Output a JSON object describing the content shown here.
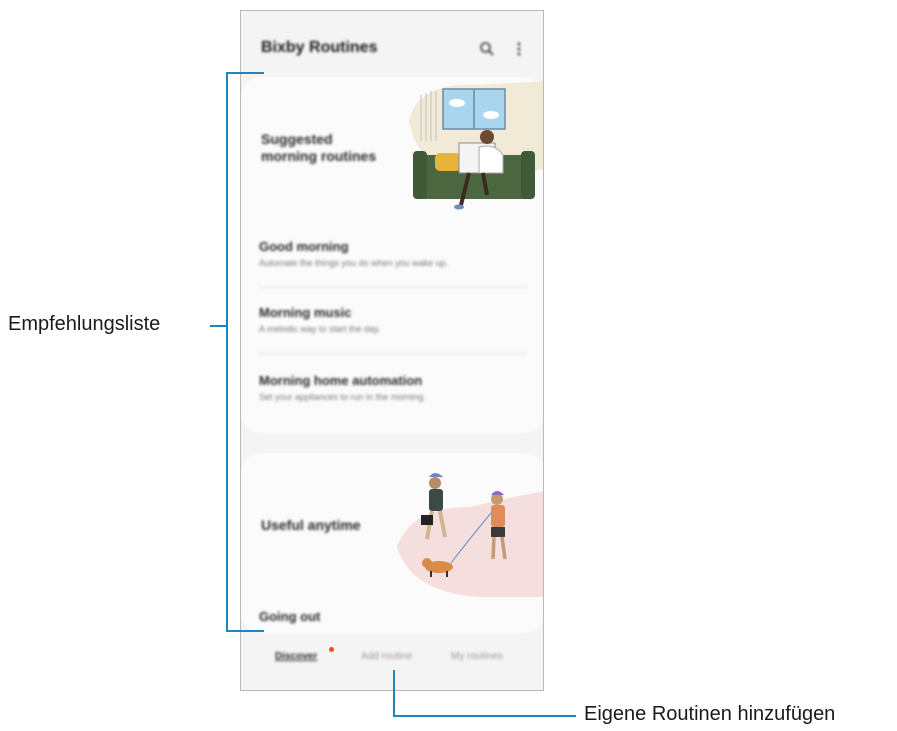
{
  "header": {
    "title": "Bixby Routines",
    "search_icon": "search-icon",
    "more_icon": "more-vertical-icon"
  },
  "suggested": {
    "title_line1": "Suggested",
    "title_line2": "morning routines",
    "items": [
      {
        "title": "Good morning",
        "subtitle": "Automate the things you do when you wake up."
      },
      {
        "title": "Morning music",
        "subtitle": "A melodic way to start the day."
      },
      {
        "title": "Morning home automation",
        "subtitle": "Set your appliances to run in the morning."
      }
    ]
  },
  "useful": {
    "title": "Useful anytime",
    "first_item": "Going out"
  },
  "bottom_nav": {
    "tabs": [
      "Discover",
      "Add routine",
      "My routines"
    ],
    "active": "Discover",
    "notification_color": "#e8502f"
  },
  "callouts": {
    "left": "Empfehlungsliste",
    "bottom": "Eigene Routinen hinzufügen",
    "line_color": "#1d86bd"
  }
}
